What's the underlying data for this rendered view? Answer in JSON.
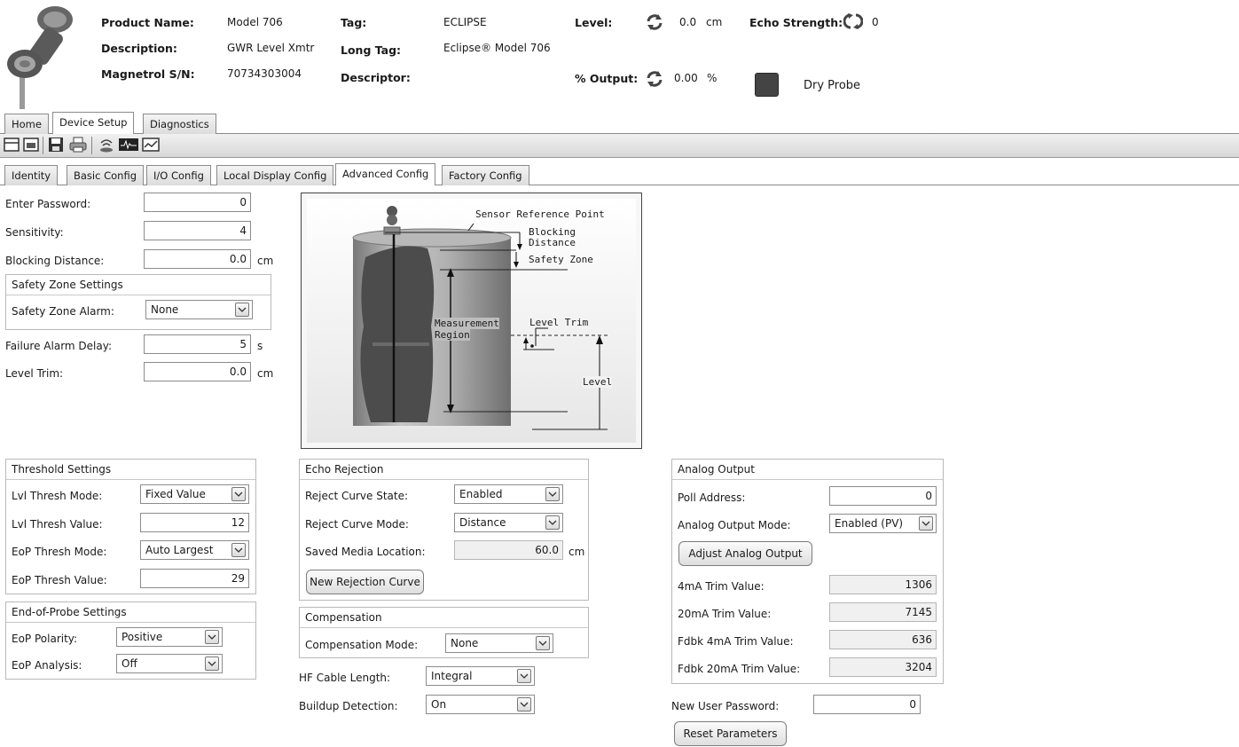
{
  "header": {
    "product_name_label": "Product Name:",
    "product_name": "Model 706",
    "description_label": "Description:",
    "description": "GWR Level Xmtr",
    "serial_label": "Magnetrol S/N:",
    "serial": "70734303004",
    "tag_label": "Tag:",
    "tag": "ECLIPSE",
    "long_tag_label": "Long Tag:",
    "long_tag": "Eclipse® Model 706",
    "descriptor_label": "Descriptor:",
    "descriptor": "",
    "level_label": "Level:",
    "level_value": "0.0",
    "level_unit": "cm",
    "echo_label": "Echo Strength:",
    "echo_value": "0",
    "output_label": "% Output:",
    "output_value": "0.00",
    "output_unit": "%",
    "status_text": "Dry Probe"
  },
  "main_tabs": [
    "Home",
    "Device Setup",
    "Diagnostics"
  ],
  "sub_tabs": [
    "Identity",
    "Basic Config",
    "I/O Config",
    "Local Display Config",
    "Advanced Config",
    "Factory Config"
  ],
  "top_fields": {
    "password_label": "Enter Password:",
    "password": "0",
    "sensitivity_label": "Sensitivity:",
    "sensitivity": "4",
    "blocking_label": "Blocking Distance:",
    "blocking": "0.0",
    "blocking_unit": "cm",
    "safety_group": "Safety Zone Settings",
    "safety_alarm_label": "Safety Zone Alarm:",
    "safety_alarm": "None",
    "failure_label": "Failure Alarm Delay:",
    "failure": "5",
    "failure_unit": "s",
    "trim_label": "Level Trim:",
    "trim": "0.0",
    "trim_unit": "cm"
  },
  "diagram": {
    "sensor_ref": "Sensor Reference Point",
    "blocking": "Blocking",
    "distance": "Distance",
    "safety": "Safety Zone",
    "measurement": "Measurement",
    "region": "Region",
    "level_trim": "Level Trim",
    "level": "Level"
  },
  "threshold": {
    "title": "Threshold Settings",
    "lvl_mode_label": "Lvl Thresh Mode:",
    "lvl_mode": "Fixed Value",
    "lvl_value_label": "Lvl Thresh Value:",
    "lvl_value": "12",
    "eop_mode_label": "EoP Thresh Mode:",
    "eop_mode": "Auto Largest",
    "eop_value_label": "EoP Thresh Value:",
    "eop_value": "29"
  },
  "eop": {
    "title": "End-of-Probe Settings",
    "polarity_label": "EoP Polarity:",
    "polarity": "Positive",
    "analysis_label": "EoP Analysis:",
    "analysis": "Off"
  },
  "echo_rejection": {
    "title": "Echo Rejection",
    "state_label": "Reject Curve State:",
    "state": "Enabled",
    "mode_label": "Reject Curve Mode:",
    "mode": "Distance",
    "saved_label": "Saved Media Location:",
    "saved": "60.0",
    "saved_unit": "cm",
    "new_curve_button": "New Rejection Curve"
  },
  "compensation": {
    "title": "Compensation",
    "mode_label": "Compensation Mode:",
    "mode": "None"
  },
  "misc": {
    "hf_label": "HF Cable Length:",
    "hf": "Integral",
    "buildup_label": "Buildup Detection:",
    "buildup": "On"
  },
  "analog": {
    "title": "Analog Output",
    "poll_label": "Poll Address:",
    "poll": "0",
    "mode_label": "Analog Output Mode:",
    "mode": "Enabled (PV)",
    "adjust_button": "Adjust Analog Output",
    "trim4_label": "4mA Trim Value:",
    "trim4": "1306",
    "trim20_label": "20mA Trim Value:",
    "trim20": "7145",
    "fdbk4_label": "Fdbk 4mA Trim Value:",
    "fdbk4": "636",
    "fdbk20_label": "Fdbk 20mA Trim Value:",
    "fdbk20": "3204"
  },
  "user": {
    "new_pw_label": "New User Password:",
    "new_pw": "0",
    "reset_button": "Reset Parameters"
  }
}
